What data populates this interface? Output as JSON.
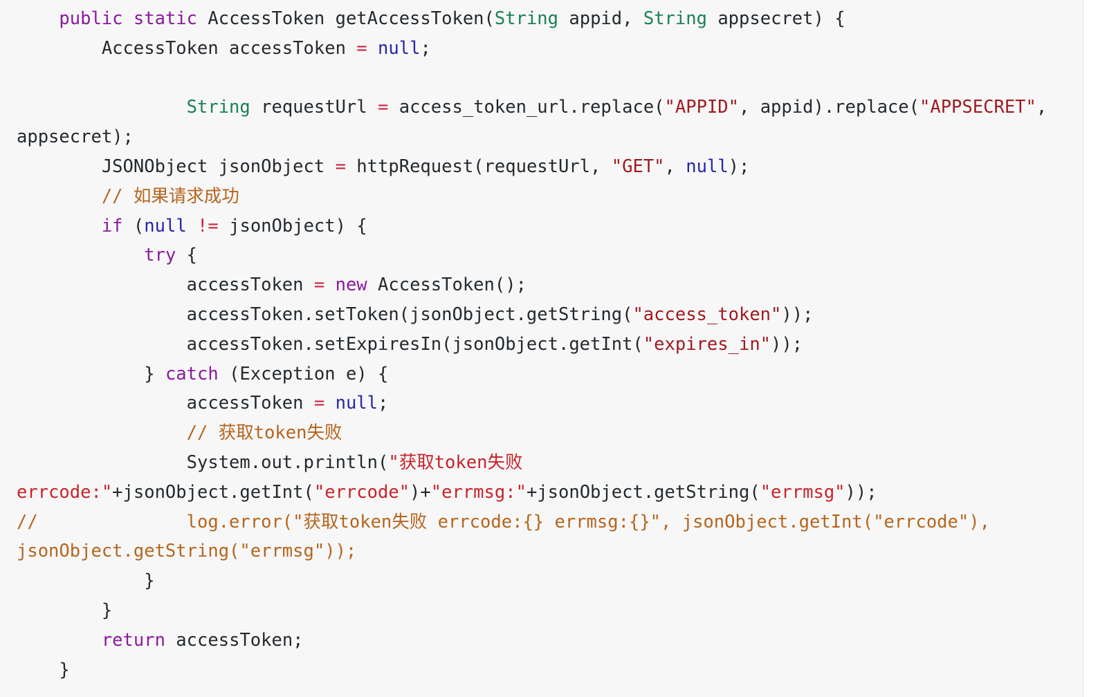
{
  "editor": {
    "language": "java",
    "background_color": "#f7f7f7",
    "default_text_color": "#24292e",
    "palette": {
      "keyword": "#8b1a9e",
      "type": "#1b8055",
      "string": "#a01a20",
      "string_bright": "#c8232b",
      "null_literal": "#2726a8",
      "operator": "#c7253e",
      "comment": "#b5651d"
    }
  },
  "code": {
    "lines": [
      {
        "index": 1,
        "text": "    public static AccessToken getAccessToken(String appid, String appsecret) {",
        "tokens": [
          {
            "t": "    ",
            "c": "pl"
          },
          {
            "t": "public static",
            "c": "kw"
          },
          {
            "t": " AccessToken getAccessToken(",
            "c": "pl"
          },
          {
            "t": "String",
            "c": "typ"
          },
          {
            "t": " appid, ",
            "c": "pl"
          },
          {
            "t": "String",
            "c": "typ"
          },
          {
            "t": " appsecret) {",
            "c": "pl"
          }
        ]
      },
      {
        "index": 2,
        "text": "        AccessToken accessToken = null;",
        "tokens": [
          {
            "t": "        AccessToken accessToken ",
            "c": "pl"
          },
          {
            "t": "=",
            "c": "op"
          },
          {
            "t": " ",
            "c": "pl"
          },
          {
            "t": "null",
            "c": "nul"
          },
          {
            "t": ";",
            "c": "pl"
          }
        ]
      },
      {
        "index": 3,
        "text": "",
        "tokens": []
      },
      {
        "index": 4,
        "text": "                String requestUrl = access_token_url.replace(\"APPID\", appid).replace(\"APPSECRET\", appsecret);",
        "tokens": [
          {
            "t": "                ",
            "c": "pl"
          },
          {
            "t": "String",
            "c": "typ"
          },
          {
            "t": " requestUrl ",
            "c": "pl"
          },
          {
            "t": "=",
            "c": "op"
          },
          {
            "t": " access_token_url.replace(",
            "c": "pl"
          },
          {
            "t": "\"APPID\"",
            "c": "str"
          },
          {
            "t": ", appid).replace(",
            "c": "pl"
          },
          {
            "t": "\"APPSECRET\"",
            "c": "str"
          },
          {
            "t": ", appsecret);",
            "c": "pl"
          }
        ]
      },
      {
        "index": 5,
        "text": "        JSONObject jsonObject = httpRequest(requestUrl, \"GET\", null);",
        "tokens": [
          {
            "t": "        JSONObject jsonObject ",
            "c": "pl"
          },
          {
            "t": "=",
            "c": "op"
          },
          {
            "t": " httpRequest(requestUrl, ",
            "c": "pl"
          },
          {
            "t": "\"GET\"",
            "c": "str"
          },
          {
            "t": ", ",
            "c": "pl"
          },
          {
            "t": "null",
            "c": "nul"
          },
          {
            "t": ");",
            "c": "pl"
          }
        ]
      },
      {
        "index": 6,
        "text": "        // 如果请求成功",
        "tokens": [
          {
            "t": "        ",
            "c": "pl"
          },
          {
            "t": "// 如果请求成功",
            "c": "cm"
          }
        ]
      },
      {
        "index": 7,
        "text": "        if (null != jsonObject) {",
        "tokens": [
          {
            "t": "        ",
            "c": "pl"
          },
          {
            "t": "if",
            "c": "kw"
          },
          {
            "t": " (",
            "c": "pl"
          },
          {
            "t": "null",
            "c": "nul"
          },
          {
            "t": " ",
            "c": "pl"
          },
          {
            "t": "!=",
            "c": "op"
          },
          {
            "t": " jsonObject) {",
            "c": "pl"
          }
        ]
      },
      {
        "index": 8,
        "text": "            try {",
        "tokens": [
          {
            "t": "            ",
            "c": "pl"
          },
          {
            "t": "try",
            "c": "kw"
          },
          {
            "t": " {",
            "c": "pl"
          }
        ]
      },
      {
        "index": 9,
        "text": "                accessToken = new AccessToken();",
        "tokens": [
          {
            "t": "                accessToken ",
            "c": "pl"
          },
          {
            "t": "=",
            "c": "op"
          },
          {
            "t": " ",
            "c": "pl"
          },
          {
            "t": "new",
            "c": "kw"
          },
          {
            "t": " AccessToken();",
            "c": "pl"
          }
        ]
      },
      {
        "index": 10,
        "text": "                accessToken.setToken(jsonObject.getString(\"access_token\"));",
        "tokens": [
          {
            "t": "                accessToken.setToken(jsonObject.getString(",
            "c": "pl"
          },
          {
            "t": "\"access_token\"",
            "c": "str"
          },
          {
            "t": "));",
            "c": "pl"
          }
        ]
      },
      {
        "index": 11,
        "text": "                accessToken.setExpiresIn(jsonObject.getInt(\"expires_in\"));",
        "tokens": [
          {
            "t": "                accessToken.setExpiresIn(jsonObject.getInt(",
            "c": "pl"
          },
          {
            "t": "\"expires_in\"",
            "c": "str"
          },
          {
            "t": "));",
            "c": "pl"
          }
        ]
      },
      {
        "index": 12,
        "text": "            } catch (Exception e) {",
        "tokens": [
          {
            "t": "            } ",
            "c": "pl"
          },
          {
            "t": "catch",
            "c": "kw"
          },
          {
            "t": " (Exception e) {",
            "c": "pl"
          }
        ]
      },
      {
        "index": 13,
        "text": "                accessToken = null;",
        "tokens": [
          {
            "t": "                accessToken ",
            "c": "pl"
          },
          {
            "t": "=",
            "c": "op"
          },
          {
            "t": " ",
            "c": "pl"
          },
          {
            "t": "null",
            "c": "nul"
          },
          {
            "t": ";",
            "c": "pl"
          }
        ]
      },
      {
        "index": 14,
        "text": "                // 获取token失败",
        "tokens": [
          {
            "t": "                ",
            "c": "pl"
          },
          {
            "t": "// 获取token失败",
            "c": "cm"
          }
        ]
      },
      {
        "index": 15,
        "text": "                System.out.println(\"获取token失败 errcode:\"+jsonObject.getInt(\"errcode\")+\"errmsg:\"+jsonObject.getString(\"errmsg\"));",
        "tokens": [
          {
            "t": "                System.out.println(",
            "c": "pl"
          },
          {
            "t": "\"获取token失败 errcode:\"",
            "c": "str2"
          },
          {
            "t": "+jsonObject.getInt(",
            "c": "pl"
          },
          {
            "t": "\"errcode\"",
            "c": "str2"
          },
          {
            "t": ")+",
            "c": "pl"
          },
          {
            "t": "\"errmsg:\"",
            "c": "str2"
          },
          {
            "t": "+jsonObject.getString(",
            "c": "pl"
          },
          {
            "t": "\"errmsg\"",
            "c": "str2"
          },
          {
            "t": "));",
            "c": "pl"
          }
        ]
      },
      {
        "index": 16,
        "text": "//              log.error(\"获取token失败 errcode:{} errmsg:{}\", jsonObject.getInt(\"errcode\"), jsonObject.getString(\"errmsg\"));",
        "tokens": [
          {
            "t": "//              log.error(\"获取token失败 errcode:{} errmsg:{}\", jsonObject.getInt(\"errcode\"), jsonObject.getString(\"errmsg\"));",
            "c": "cm"
          }
        ]
      },
      {
        "index": 17,
        "text": "            }",
        "tokens": [
          {
            "t": "            }",
            "c": "pl"
          }
        ]
      },
      {
        "index": 18,
        "text": "        }",
        "tokens": [
          {
            "t": "        }",
            "c": "pl"
          }
        ]
      },
      {
        "index": 19,
        "text": "        return accessToken;",
        "tokens": [
          {
            "t": "        ",
            "c": "pl"
          },
          {
            "t": "return",
            "c": "kw"
          },
          {
            "t": " accessToken;",
            "c": "pl"
          }
        ]
      },
      {
        "index": 20,
        "text": "    }",
        "tokens": [
          {
            "t": "    }",
            "c": "pl"
          }
        ]
      }
    ]
  }
}
